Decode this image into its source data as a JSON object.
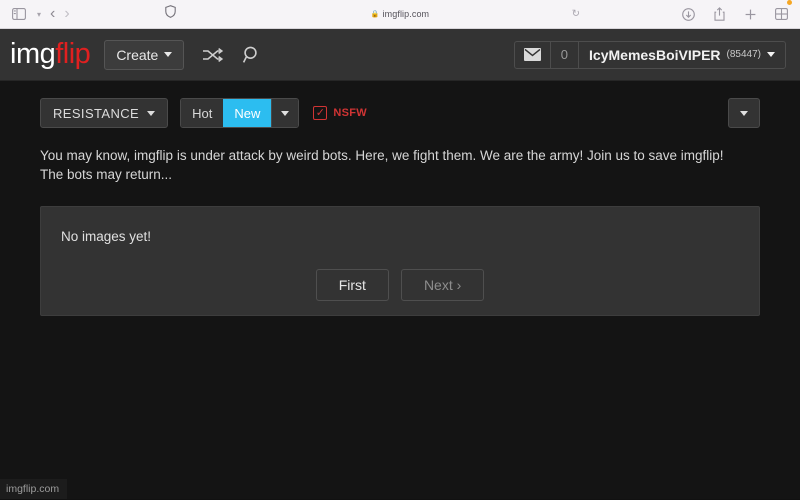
{
  "browser": {
    "sidebar_icon": "sidebar-icon",
    "sidebar_caret_icon": "chevron-down-icon",
    "back_icon": "back-arrow-icon",
    "forward_icon": "forward-arrow-icon",
    "shield_icon": "shield-icon",
    "lock_icon": "lock-icon",
    "url": "imgflip.com",
    "reload_icon": "reload-icon",
    "downloads_icon": "downloads-icon",
    "share_icon": "share-icon",
    "new_tab_icon": "plus-icon",
    "tab_overview_icon": "tab-overview-icon"
  },
  "header": {
    "logo_part1": "img",
    "logo_part2": "flip",
    "create_label": "Create",
    "shuffle_icon": "shuffle-icon",
    "search_icon": "search-icon",
    "mail_icon": "mail-icon",
    "notification_count": "0",
    "username": "IcyMemesBoiVIPER",
    "user_points": "(85447)"
  },
  "filters": {
    "stream_name": "RESISTANCE",
    "sort_hot": "Hot",
    "sort_new": "New",
    "sort_active": "New",
    "nsfw_label": "NSFW",
    "nsfw_checked": true,
    "nsfw_check_glyph": "✓",
    "accent_color": "#2cbdf0",
    "nsfw_color": "#d03434"
  },
  "stream": {
    "description": "You may know, imgflip is under attack by weird bots. Here, we fight them. We are the army! Join us to save imgflip! The bots may return...",
    "empty_message": "No images yet!",
    "pager_first": "First",
    "pager_next": "Next ›"
  },
  "status": {
    "link_preview": "imgflip.com"
  }
}
